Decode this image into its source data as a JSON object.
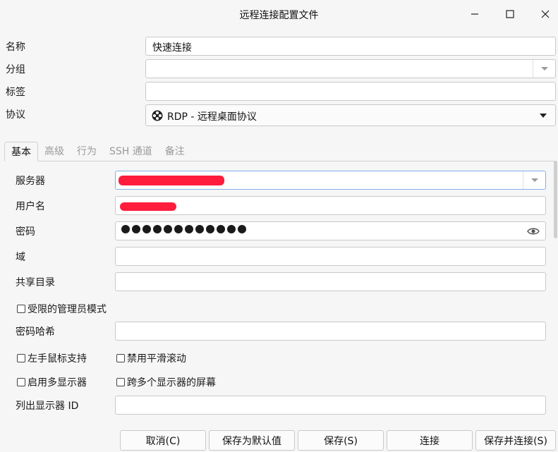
{
  "window": {
    "title": "远程连接配置文件",
    "minimize": "—",
    "maximize": "☐",
    "close": "✕"
  },
  "form": {
    "name_label": "名称",
    "name_value": "快速连接",
    "group_label": "分组",
    "group_value": "",
    "tags_label": "标签",
    "tags_value": "",
    "protocol_label": "协议",
    "protocol_value": "RDP - 远程桌面协议"
  },
  "tabs": [
    {
      "label": "基本",
      "active": true
    },
    {
      "label": "高级",
      "active": false
    },
    {
      "label": "行为",
      "active": false
    },
    {
      "label": "SSH 通道",
      "active": false
    },
    {
      "label": "备注",
      "active": false
    }
  ],
  "basic": {
    "server_label": "服务器",
    "username_label": "用户名",
    "password_label": "密码",
    "password_dots": 12,
    "domain_label": "域",
    "domain_value": "",
    "share_label": "共享目录",
    "share_value": "",
    "restricted_admin_label": "受限的管理员模式",
    "password_hash_label": "密码哈希",
    "password_hash_value": "",
    "left_mouse_label": "左手鼠标支持",
    "disable_smooth_label": "禁用平滑滚动",
    "multi_monitor_label": "启用多显示器",
    "span_monitors_label": "跨多个显示器的屏幕",
    "list_monitor_label": "列出显示器 ID",
    "list_monitor_value": ""
  },
  "buttons": {
    "cancel": "取消(C)",
    "save_default": "保存为默认值",
    "save": "保存(S)",
    "connect": "连接",
    "save_connect": "保存并连接(S)"
  },
  "colors": {
    "background": "#f6f6f6",
    "redaction": "#ff1c3c",
    "focus_border": "#7fb0e6"
  }
}
